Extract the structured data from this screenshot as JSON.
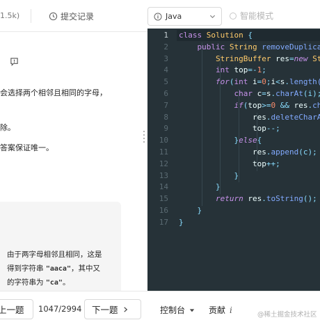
{
  "topbar": {
    "partial_tab": "1.5k)",
    "submissions_label": "提交记录",
    "language": "Java",
    "smart_mode_label": "智能模式"
  },
  "problem": {
    "lines": [
      "会选择两个相邻且相同的字母，",
      "除。",
      "答案保证唯一。"
    ],
    "example": {
      "line1": "由于两字母相邻且相同，这是",
      "line2_pre": "得到字符串 ",
      "line2_code": "\"aaca\"",
      "line2_post": "，其中又",
      "line3_pre": "的字符串为 ",
      "line3_code": "\"ca\"",
      "line3_post": "。"
    }
  },
  "editor": {
    "line_numbers": [
      "1",
      "2",
      "3",
      "4",
      "5",
      "6",
      "7",
      "8",
      "9",
      "10",
      "11",
      "12",
      "13",
      "14",
      "15",
      "16",
      "17"
    ],
    "active_line": "1",
    "code_lines": [
      [
        {
          "t": "class ",
          "c": "kw"
        },
        {
          "t": "Solution ",
          "c": "cls"
        },
        {
          "t": "{",
          "c": "op"
        }
      ],
      [
        {
          "t": "    public ",
          "c": "kw"
        },
        {
          "t": "String ",
          "c": "cls"
        },
        {
          "t": "removeDuplica",
          "c": "fn"
        }
      ],
      [
        {
          "t": "        StringBuffer ",
          "c": "cls"
        },
        {
          "t": "res",
          "c": "pl"
        },
        {
          "t": "=",
          "c": "op"
        },
        {
          "t": "new ",
          "c": "kwi"
        },
        {
          "t": "St",
          "c": "cls"
        }
      ],
      [
        {
          "t": "        int ",
          "c": "kw"
        },
        {
          "t": "top",
          "c": "pl"
        },
        {
          "t": "=-",
          "c": "op"
        },
        {
          "t": "1",
          "c": "num"
        },
        {
          "t": ";",
          "c": "op"
        }
      ],
      [
        {
          "t": "        for",
          "c": "kwi"
        },
        {
          "t": "(",
          "c": "op"
        },
        {
          "t": "int ",
          "c": "kw"
        },
        {
          "t": "i",
          "c": "pl"
        },
        {
          "t": "=",
          "c": "op"
        },
        {
          "t": "0",
          "c": "num"
        },
        {
          "t": ";",
          "c": "op"
        },
        {
          "t": "i",
          "c": "pl"
        },
        {
          "t": "<",
          "c": "op"
        },
        {
          "t": "s",
          "c": "pl"
        },
        {
          "t": ".",
          "c": "op"
        },
        {
          "t": "length(",
          "c": "fn"
        }
      ],
      [
        {
          "t": "            char ",
          "c": "kw"
        },
        {
          "t": "c",
          "c": "pl"
        },
        {
          "t": "=",
          "c": "op"
        },
        {
          "t": "s",
          "c": "pl"
        },
        {
          "t": ".",
          "c": "op"
        },
        {
          "t": "charAt",
          "c": "fn"
        },
        {
          "t": "(i);",
          "c": "op"
        }
      ],
      [
        {
          "t": "            if",
          "c": "kwi"
        },
        {
          "t": "(",
          "c": "op"
        },
        {
          "t": "top",
          "c": "pl"
        },
        {
          "t": ">=",
          "c": "op"
        },
        {
          "t": "0 ",
          "c": "num"
        },
        {
          "t": "&& ",
          "c": "op"
        },
        {
          "t": "res",
          "c": "pl"
        },
        {
          "t": ".",
          "c": "op"
        },
        {
          "t": "ch",
          "c": "fn"
        }
      ],
      [
        {
          "t": "                res",
          "c": "pl"
        },
        {
          "t": ".",
          "c": "op"
        },
        {
          "t": "deleteCharA",
          "c": "fn"
        }
      ],
      [
        {
          "t": "                top",
          "c": "pl"
        },
        {
          "t": "--;",
          "c": "op"
        }
      ],
      [
        {
          "t": "            }",
          "c": "op"
        },
        {
          "t": "else",
          "c": "kwi"
        },
        {
          "t": "{",
          "c": "op"
        }
      ],
      [
        {
          "t": "                res",
          "c": "pl"
        },
        {
          "t": ".",
          "c": "op"
        },
        {
          "t": "append",
          "c": "fn"
        },
        {
          "t": "(c);",
          "c": "op"
        }
      ],
      [
        {
          "t": "                top",
          "c": "pl"
        },
        {
          "t": "++;",
          "c": "op"
        }
      ],
      [
        {
          "t": "            }",
          "c": "op"
        }
      ],
      [
        {
          "t": "        }",
          "c": "op"
        }
      ],
      [
        {
          "t": "        return ",
          "c": "kwi"
        },
        {
          "t": "res",
          "c": "pl"
        },
        {
          "t": ".",
          "c": "op"
        },
        {
          "t": "toString",
          "c": "fn"
        },
        {
          "t": "();",
          "c": "op"
        }
      ],
      [
        {
          "t": "    }",
          "c": "op"
        }
      ],
      [
        {
          "t": "}",
          "c": "op"
        }
      ]
    ]
  },
  "bottombar": {
    "prev_label": "上一题",
    "counter": "1047/2994",
    "next_label": "下一题",
    "console_label": "控制台",
    "contribute_label": "贡献",
    "contribute_icon_text": "i"
  },
  "watermark": "@稀土掘金技术社区"
}
